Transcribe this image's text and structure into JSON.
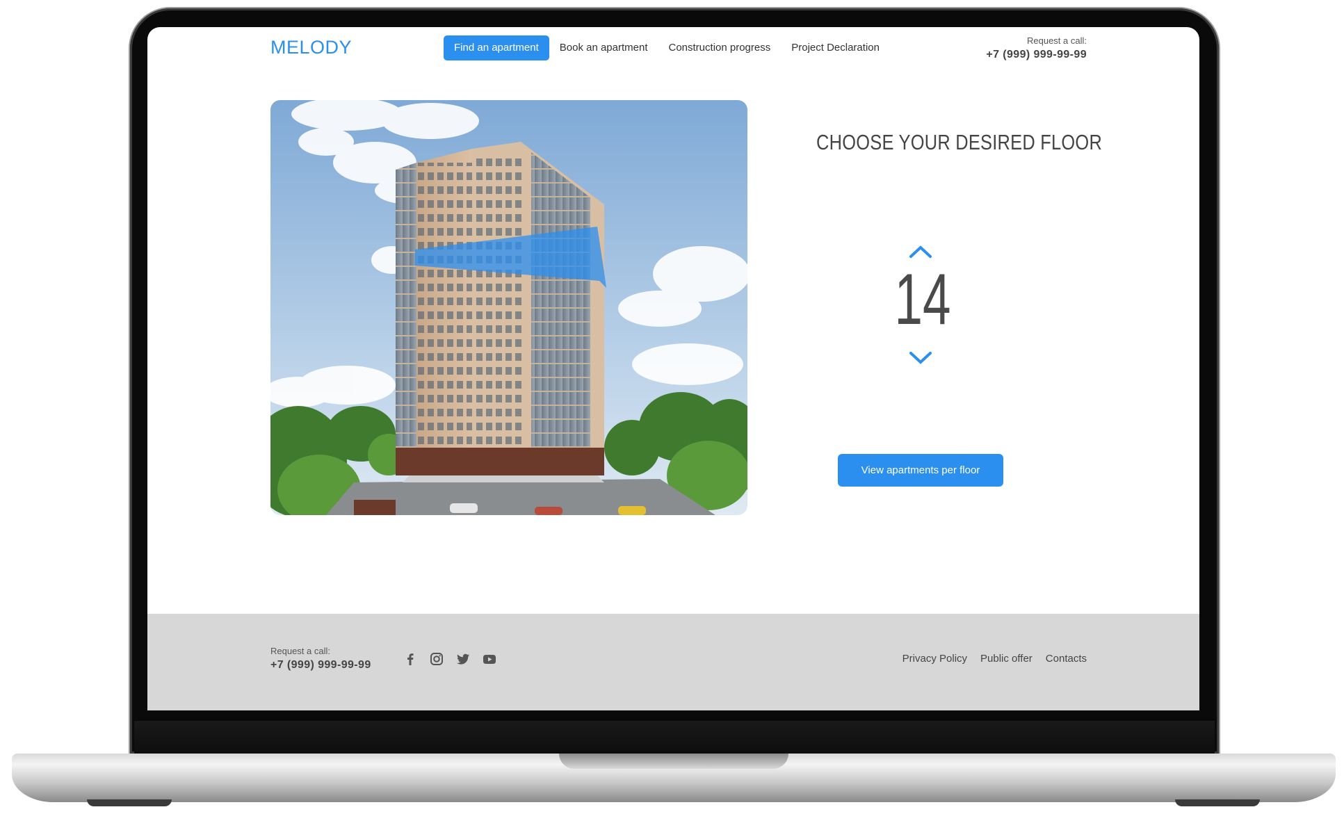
{
  "brand": {
    "name": "MELODY",
    "color": "#2b8ff0"
  },
  "nav": {
    "items": [
      {
        "label": "Find an apartment",
        "active": true
      },
      {
        "label": "Book an apartment",
        "active": false
      },
      {
        "label": "Construction progress",
        "active": false
      },
      {
        "label": "Project Declaration",
        "active": false
      }
    ]
  },
  "header_call": {
    "label": "Request a call:",
    "phone": "+7 (999) 999-99-99"
  },
  "floor_chooser": {
    "title": "CHOOSE YOUR DESIRED FLOOR",
    "selected_floor": "14",
    "up_icon": "chevron-up-icon",
    "down_icon": "chevron-down-icon",
    "button_label": "View apartments per floor"
  },
  "footer": {
    "call_label": "Request a call:",
    "phone": "+7 (999) 999-99-99",
    "socials": [
      "facebook-icon",
      "instagram-icon",
      "twitter-icon",
      "youtube-icon"
    ],
    "links": [
      "Privacy Policy",
      "Public offer",
      "Contacts"
    ]
  },
  "colors": {
    "accent": "#2b8ff0",
    "footer_bg": "#d7d7d7",
    "text": "#444444"
  }
}
